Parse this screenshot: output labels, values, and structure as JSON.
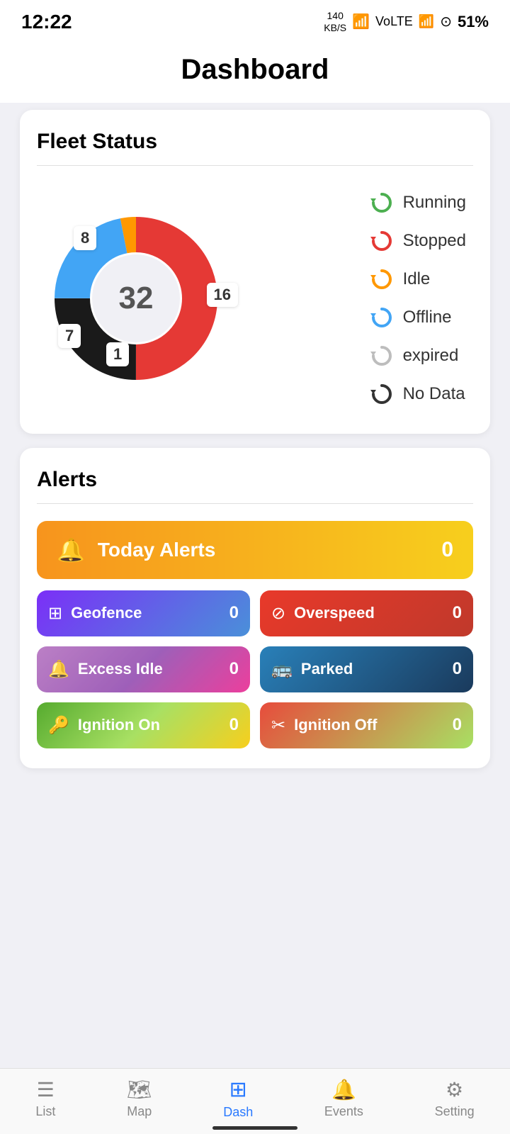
{
  "statusBar": {
    "time": "12:22",
    "kb": "140\nKB/S",
    "battery": "51%"
  },
  "header": {
    "title": "Dashboard"
  },
  "fleetStatus": {
    "title": "Fleet Status",
    "centerValue": "32",
    "segments": {
      "running": 16,
      "stopped": 8,
      "offline": 7,
      "idle": 1
    },
    "legend": [
      {
        "id": "running",
        "label": "Running",
        "color": "#4caf50"
      },
      {
        "id": "stopped",
        "label": "Stopped",
        "color": "#e53935"
      },
      {
        "id": "idle",
        "label": "Idle",
        "color": "#ff9800"
      },
      {
        "id": "offline",
        "label": "Offline",
        "color": "#42a5f5"
      },
      {
        "id": "expired",
        "label": "expired",
        "color": "#bdbdbd"
      },
      {
        "id": "nodata",
        "label": "No Data",
        "color": "#333"
      }
    ]
  },
  "alerts": {
    "title": "Alerts",
    "todayAlerts": {
      "label": "Today Alerts",
      "count": "0"
    },
    "items": [
      {
        "id": "geofence",
        "label": "Geofence",
        "count": "0",
        "icon": "⊞"
      },
      {
        "id": "overspeed",
        "label": "Overspeed",
        "count": "0",
        "icon": "⊘"
      },
      {
        "id": "excess-idle",
        "label": "Excess Idle",
        "count": "0",
        "icon": "🔔"
      },
      {
        "id": "parked",
        "label": "Parked",
        "count": "0",
        "icon": "🚌"
      },
      {
        "id": "ignition-on",
        "label": "Ignition On",
        "count": "0",
        "icon": "🔑"
      },
      {
        "id": "ignition-off",
        "label": "Ignition Off",
        "count": "0",
        "icon": "✂"
      }
    ]
  },
  "bottomNav": {
    "items": [
      {
        "id": "list",
        "label": "List",
        "icon": "☰",
        "active": false
      },
      {
        "id": "map",
        "label": "Map",
        "icon": "🗺",
        "active": false
      },
      {
        "id": "dash",
        "label": "Dash",
        "icon": "⊞",
        "active": true
      },
      {
        "id": "events",
        "label": "Events",
        "icon": "🔔",
        "active": false
      },
      {
        "id": "setting",
        "label": "Setting",
        "icon": "⚙",
        "active": false
      }
    ]
  }
}
